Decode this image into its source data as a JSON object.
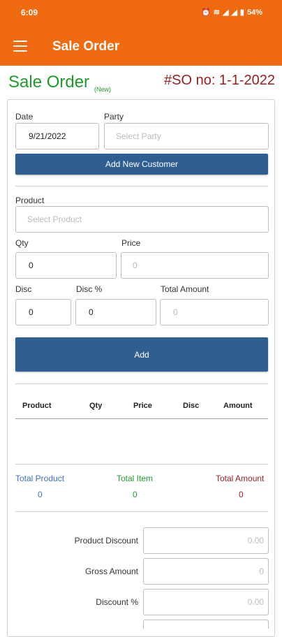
{
  "status": {
    "time": "6:09",
    "battery": "54%"
  },
  "app_bar": {
    "title": "Sale Order"
  },
  "header": {
    "heading": "Sale Order",
    "badge": "(New)",
    "so_number": "#SO no:  1-1-2022"
  },
  "form": {
    "date_label": "Date",
    "date_value": "9/21/2022",
    "party_label": "Party",
    "party_placeholder": "Select Party",
    "add_customer_label": "Add New Customer",
    "product_label": "Product",
    "product_placeholder": "Select Product",
    "qty_label": "Qty",
    "qty_value": "0",
    "price_label": "Price",
    "price_placeholder": "0",
    "disc_label": "Disc",
    "disc_value": "0",
    "disc_pct_label": "Disc %",
    "disc_pct_value": "0",
    "total_amount_label": "Total Amount",
    "total_amount_placeholder": "0",
    "add_label": "Add"
  },
  "table": {
    "columns": [
      "Product",
      "Qty",
      "Price",
      "Disc",
      "Amount"
    ]
  },
  "summary": {
    "total_product_label": "Total Product",
    "total_product_value": "0",
    "total_item_label": "Total Item",
    "total_item_value": "0",
    "total_amount_label": "Total Amount",
    "total_amount_value": "0"
  },
  "totals": {
    "product_discount_label": "Product Discount",
    "product_discount_value": "0.00",
    "gross_amount_label": "Gross Amount",
    "gross_amount_value": "0",
    "discount_pct_label": "Discount %",
    "discount_pct_value": "0.00"
  },
  "colors": {
    "brand": "#f06a10",
    "button": "#2f5f91",
    "green": "#1e9b2a",
    "red": "#9b1c1c",
    "blue": "#3a6fc4"
  }
}
